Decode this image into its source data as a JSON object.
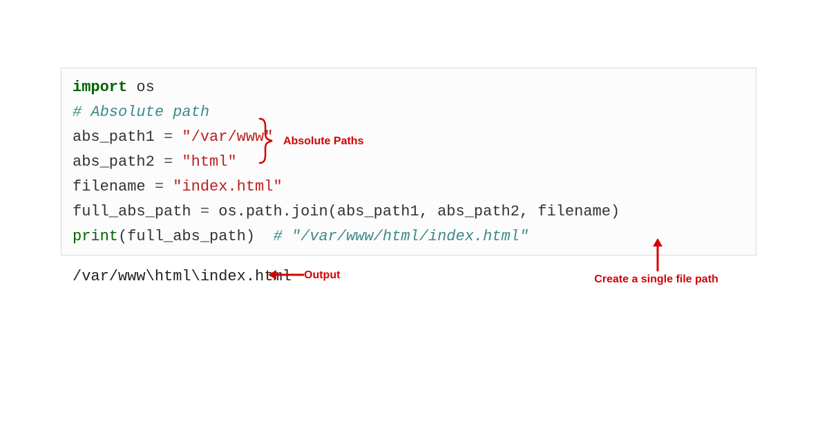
{
  "code": {
    "line1": {
      "kw": "import",
      "module": " os"
    },
    "blank": "",
    "comment1": "# Absolute path",
    "line3_a": "abs_path1 ",
    "line3_b": "=",
    "line3_c": " \"/var/www\"",
    "line4_a": "abs_path2 ",
    "line4_b": "=",
    "line4_c": " \"html\"",
    "line5_a": "filename ",
    "line5_b": "=",
    "line5_c": " \"index.html\"",
    "line6_a": "full_abs_path ",
    "line6_b": "=",
    "line6_c": " os.path.join(abs_path1, abs_path2, filename)",
    "line7_a": "print",
    "line7_b": "(full_abs_path)  ",
    "line7_c": "# \"/var/www/html/index.html\""
  },
  "output": "/var/www\\html\\index.html",
  "annotations": {
    "abs_paths": "Absolute Paths",
    "output_label": "Output",
    "single_path": "Create a single file path"
  }
}
